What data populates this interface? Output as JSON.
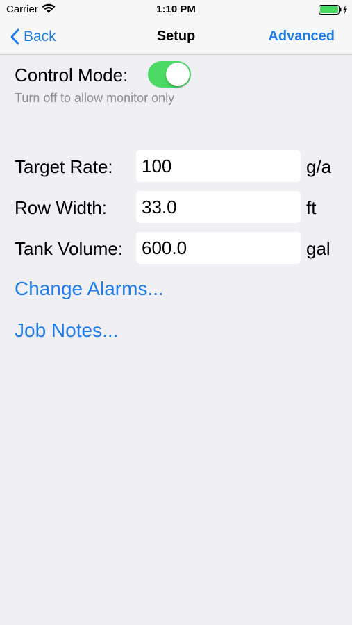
{
  "status_bar": {
    "carrier": "Carrier",
    "time": "1:10 PM",
    "wifi_icon": "wifi-icon",
    "battery_icon": "battery-charging-icon",
    "battery_color": "#4cd964"
  },
  "nav": {
    "back_label": "Back",
    "title": "Setup",
    "right_label": "Advanced",
    "accent_color": "#1f7ce8"
  },
  "control_mode": {
    "label": "Control Mode:",
    "enabled": true,
    "hint": "Turn off to allow monitor only",
    "toggle_color": "#4cd964"
  },
  "fields": {
    "target_rate": {
      "label": "Target Rate:",
      "value": "100",
      "unit": "g/a"
    },
    "row_width": {
      "label": "Row Width:",
      "value": "33.0",
      "unit": "ft"
    },
    "tank_volume": {
      "label": "Tank Volume:",
      "value": "600.0",
      "unit": "gal"
    }
  },
  "links": {
    "change_alarms": "Change Alarms...",
    "job_notes": "Job Notes..."
  }
}
